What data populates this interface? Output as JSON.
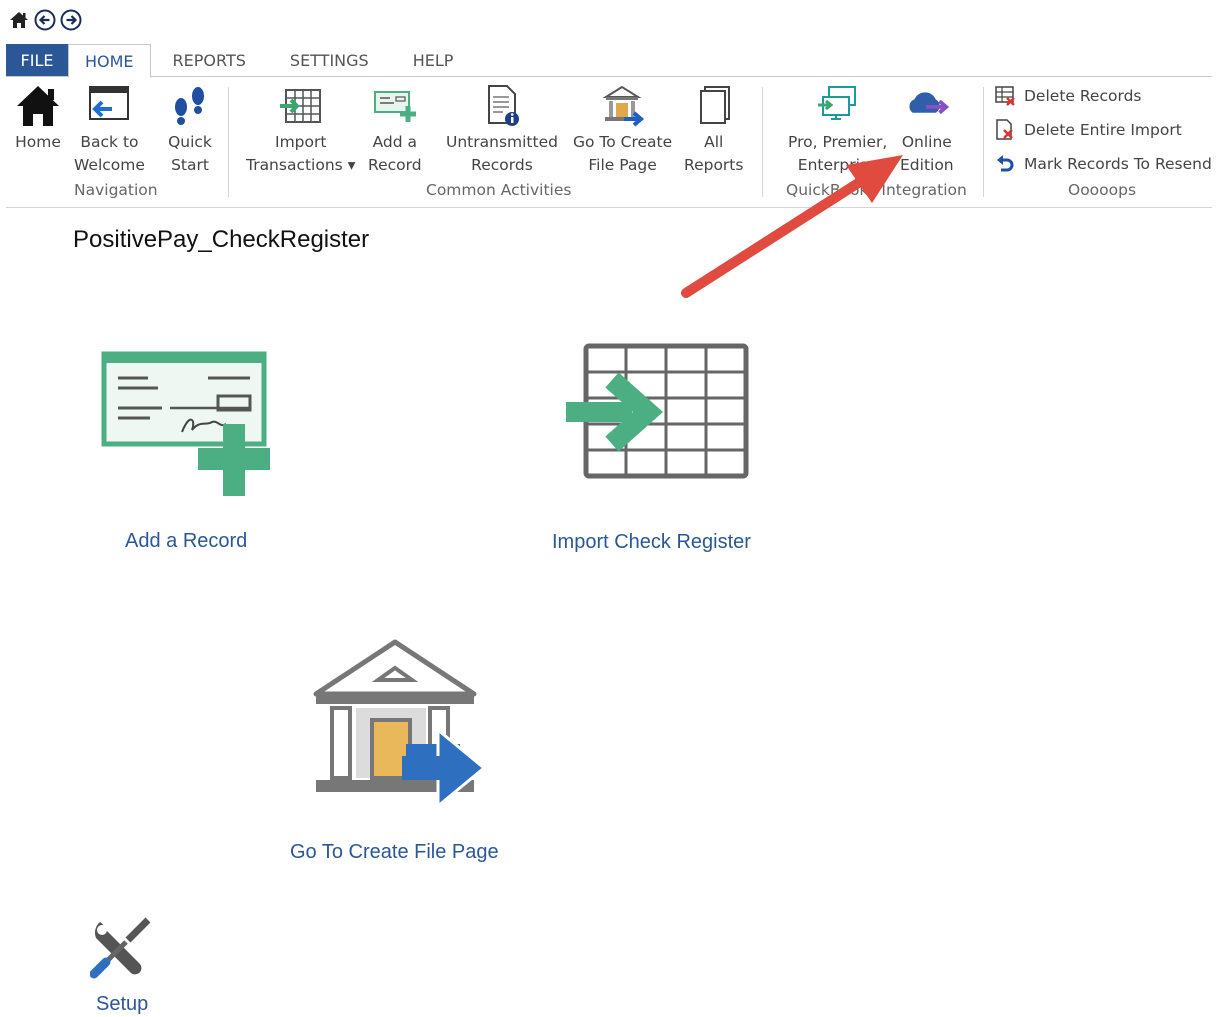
{
  "tabs": [
    {
      "label": "FILE"
    },
    {
      "label": "HOME"
    },
    {
      "label": "REPORTS"
    },
    {
      "label": "SETTINGS"
    },
    {
      "label": "HELP"
    }
  ],
  "ribbon": {
    "navigation": {
      "group_label": "Navigation",
      "home": "Home",
      "back_line1": "Back to",
      "back_line2": "Welcome",
      "quick_line1": "Quick",
      "quick_line2": "Start"
    },
    "common": {
      "group_label": "Common Activities",
      "import_line1": "Import",
      "import_line2": "Transactions ▾",
      "add_line1": "Add a",
      "add_line2": "Record",
      "untrans_line1": "Untransmitted",
      "untrans_line2": "Records",
      "goto_line1": "Go To Create",
      "goto_line2": "File Page",
      "all_line1": "All",
      "all_line2": "Reports"
    },
    "quickbooks": {
      "group_label": "QuickBooks Integration",
      "pro_line1": "Pro, Premier,",
      "pro_line2": "Enterprise",
      "online_line1": "Online",
      "online_line2": "Edition"
    },
    "oops": {
      "group_label": "Ooooops",
      "delete_records": "Delete Records",
      "delete_import": "Delete Entire Import",
      "mark_resend": "Mark Records To Resend"
    }
  },
  "page": {
    "title": "PositivePay_CheckRegister"
  },
  "tiles": {
    "add_record": "Add a Record",
    "import_register": "Import Check Register",
    "goto_create": "Go To Create File Page",
    "setup": "Setup"
  },
  "colors": {
    "accent": "#2b5797",
    "green": "#4caf84",
    "annotation_arrow": "#e04a3f"
  }
}
